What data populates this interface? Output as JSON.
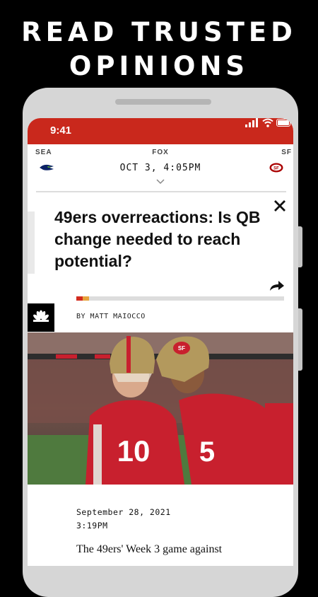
{
  "promo": {
    "line1": "READ TRUSTED",
    "line2": "OPINIONS"
  },
  "status_bar": {
    "time": "9:41"
  },
  "scoreboard": {
    "away_team": "SEA",
    "network": "FOX",
    "home_team": "SF",
    "game_time": "OCT 3, 4:05PM"
  },
  "article": {
    "headline": "49ers overreactions: Is QB change needed to reach potential?",
    "byline": "BY MATT MAIOCCO",
    "date": "September 28, 2021",
    "time": "3:19PM",
    "body_preview": "The 49ers' Week 3 game against",
    "reading_progress": 0.06
  },
  "photo": {
    "jersey_left_number": "10",
    "jersey_right_number": "5"
  },
  "colors": {
    "accent": "#c9281c",
    "progress_red": "#d22b1f",
    "progress_orange": "#e6a23c",
    "jersey_red": "#c8202e",
    "jersey_gold": "#b3995d"
  },
  "icons": {
    "close": "close-icon",
    "share": "share-icon",
    "chevron": "chevron-down-icon",
    "network_logo": "nbc-peacock-icon",
    "away_logo": "seahawks-logo",
    "home_logo": "49ers-logo"
  }
}
